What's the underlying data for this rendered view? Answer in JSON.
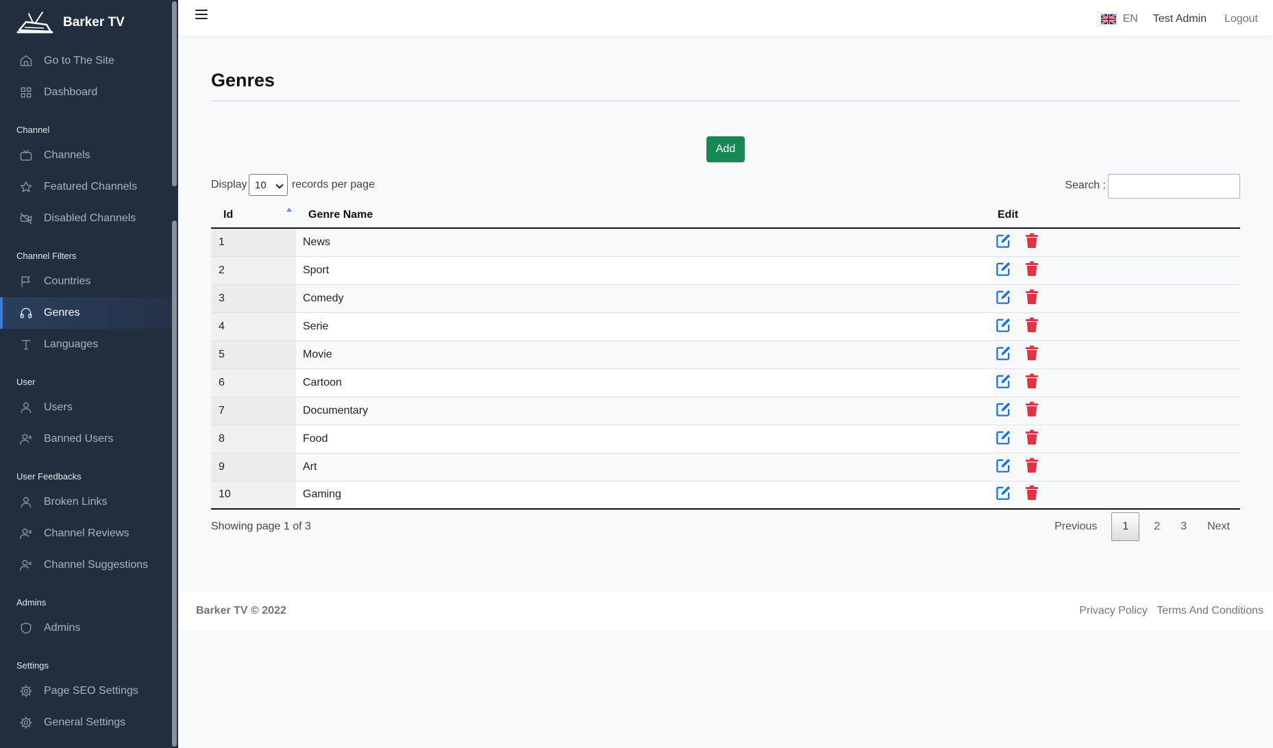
{
  "brand": {
    "name": "Barker TV"
  },
  "sidebar": {
    "top_items": [
      {
        "label": "Go to The Site",
        "icon": "home-icon"
      },
      {
        "label": "Dashboard",
        "icon": "grid-icon"
      }
    ],
    "sections": [
      {
        "title": "Channel",
        "items": [
          {
            "label": "Channels",
            "icon": "tv-icon"
          },
          {
            "label": "Featured Channels",
            "icon": "star-icon"
          },
          {
            "label": "Disabled Channels",
            "icon": "video-off-icon"
          }
        ]
      },
      {
        "title": "Channel Filters",
        "items": [
          {
            "label": "Countries",
            "icon": "flag-icon"
          },
          {
            "label": "Genres",
            "icon": "headphones-icon",
            "active": true
          },
          {
            "label": "Languages",
            "icon": "type-icon"
          }
        ]
      },
      {
        "title": "User",
        "items": [
          {
            "label": "Users",
            "icon": "user-icon"
          },
          {
            "label": "Banned Users",
            "icon": "user-x-icon"
          }
        ]
      },
      {
        "title": "User Feedbacks",
        "items": [
          {
            "label": "Broken Links",
            "icon": "user-icon"
          },
          {
            "label": "Channel Reviews",
            "icon": "user-x-icon"
          },
          {
            "label": "Channel Suggestions",
            "icon": "user-x-icon"
          }
        ]
      },
      {
        "title": "Admins",
        "items": [
          {
            "label": "Admins",
            "icon": "shield-icon"
          }
        ]
      },
      {
        "title": "Settings",
        "items": [
          {
            "label": "Page SEO Settings",
            "icon": "gear-icon"
          },
          {
            "label": "General Settings",
            "icon": "gear-icon"
          }
        ]
      }
    ]
  },
  "topbar": {
    "language": "EN",
    "user_name": "Test Admin",
    "logout": "Logout"
  },
  "page": {
    "title": "Genres",
    "add_button": "Add"
  },
  "table_controls": {
    "display_label": "Display",
    "per_page_value": "10",
    "records_label": "records per page",
    "search_label": "Search :",
    "search_value": ""
  },
  "table": {
    "columns": [
      "Id",
      "Genre Name",
      "Edit"
    ],
    "rows": [
      {
        "id": "1",
        "name": "News"
      },
      {
        "id": "2",
        "name": "Sport"
      },
      {
        "id": "3",
        "name": "Comedy"
      },
      {
        "id": "4",
        "name": "Serie"
      },
      {
        "id": "5",
        "name": "Movie"
      },
      {
        "id": "6",
        "name": "Cartoon"
      },
      {
        "id": "7",
        "name": "Documentary"
      },
      {
        "id": "8",
        "name": "Food"
      },
      {
        "id": "9",
        "name": "Art"
      },
      {
        "id": "10",
        "name": "Gaming"
      }
    ]
  },
  "pagination": {
    "status": "Showing page 1 of 3",
    "previous": "Previous",
    "pages": [
      "1",
      "2",
      "3"
    ],
    "current": "1",
    "next": "Next"
  },
  "footer": {
    "copyright": "Barker TV © 2022",
    "links": [
      "Privacy Policy",
      "Terms And Conditions"
    ]
  },
  "colors": {
    "sidebar_bg": "#222d3e",
    "accent": "#3b7ddd",
    "add_button": "#198754",
    "edit_icon": "#1a73e8",
    "delete_icon": "#dc3545"
  }
}
